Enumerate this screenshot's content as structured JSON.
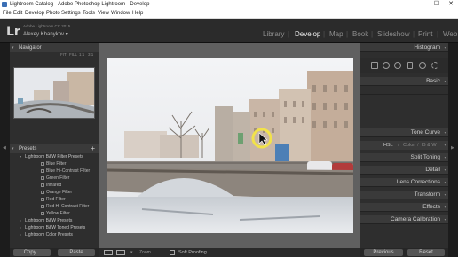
{
  "window": {
    "title": "Lightroom Catalog - Adobe Photoshop Lightroom - Develop",
    "min": "–",
    "max": "☐",
    "close": "✕"
  },
  "menu": [
    "File",
    "Edit",
    "Develop",
    "Photo",
    "Settings",
    "Tools",
    "View",
    "Window",
    "Help"
  ],
  "identity": {
    "logo": "Lr",
    "product": "Adobe Lightroom CC 2015",
    "user": "Alexey Khanykov",
    "user_arrow": "▾"
  },
  "modules": {
    "items": [
      "Library",
      "Develop",
      "Map",
      "Book",
      "Slideshow",
      "Print",
      "Web"
    ],
    "active": "Develop",
    "separator": "|"
  },
  "navigator": {
    "title": "Navigator",
    "zoom": [
      "FIT",
      "FILL",
      "1:1",
      "3:1"
    ]
  },
  "presets": {
    "title": "Presets",
    "add": "+",
    "rows": [
      {
        "label": "Lightroom B&W Filter Presets",
        "type": "folder",
        "arrow": "▾"
      },
      {
        "label": "Blue Filter",
        "type": "item"
      },
      {
        "label": "Blue Hi-Contrast Filter",
        "type": "item"
      },
      {
        "label": "Green Filter",
        "type": "item"
      },
      {
        "label": "Infrared",
        "type": "item"
      },
      {
        "label": "Orange Filter",
        "type": "item"
      },
      {
        "label": "Red Filter",
        "type": "item"
      },
      {
        "label": "Red Hi-Contrast Filter",
        "type": "item"
      },
      {
        "label": "Yellow Filter",
        "type": "item"
      },
      {
        "label": "Lightroom B&W Presets",
        "type": "folder",
        "arrow": "▸"
      },
      {
        "label": "Lightroom B&W Toned Presets",
        "type": "folder",
        "arrow": "▸"
      },
      {
        "label": "Lightroom Color Presets",
        "type": "folder",
        "arrow": "▸"
      }
    ]
  },
  "left_buttons": {
    "copy": "Copy...",
    "paste": "Paste"
  },
  "toolbar": {
    "zoom_label": "Zoom",
    "soft_proofing": "Soft Proofing"
  },
  "right_panel": {
    "histogram": "Histogram",
    "sections": [
      "Basic",
      "Tone Curve"
    ],
    "hsl": {
      "h": "HSL",
      "color": "Color",
      "bw": "B & W",
      "sep": "/"
    },
    "sections_after": [
      "Split Toning",
      "Detail",
      "Lens Corrections",
      "Transform",
      "Effects",
      "Camera Calibration"
    ]
  },
  "right_buttons": {
    "previous": "Previous",
    "reset": "Reset"
  },
  "colors": {
    "accent_cursor": "#f2e24a",
    "panel_bg": "#2e2e2e",
    "canvas_bg": "#606060"
  }
}
